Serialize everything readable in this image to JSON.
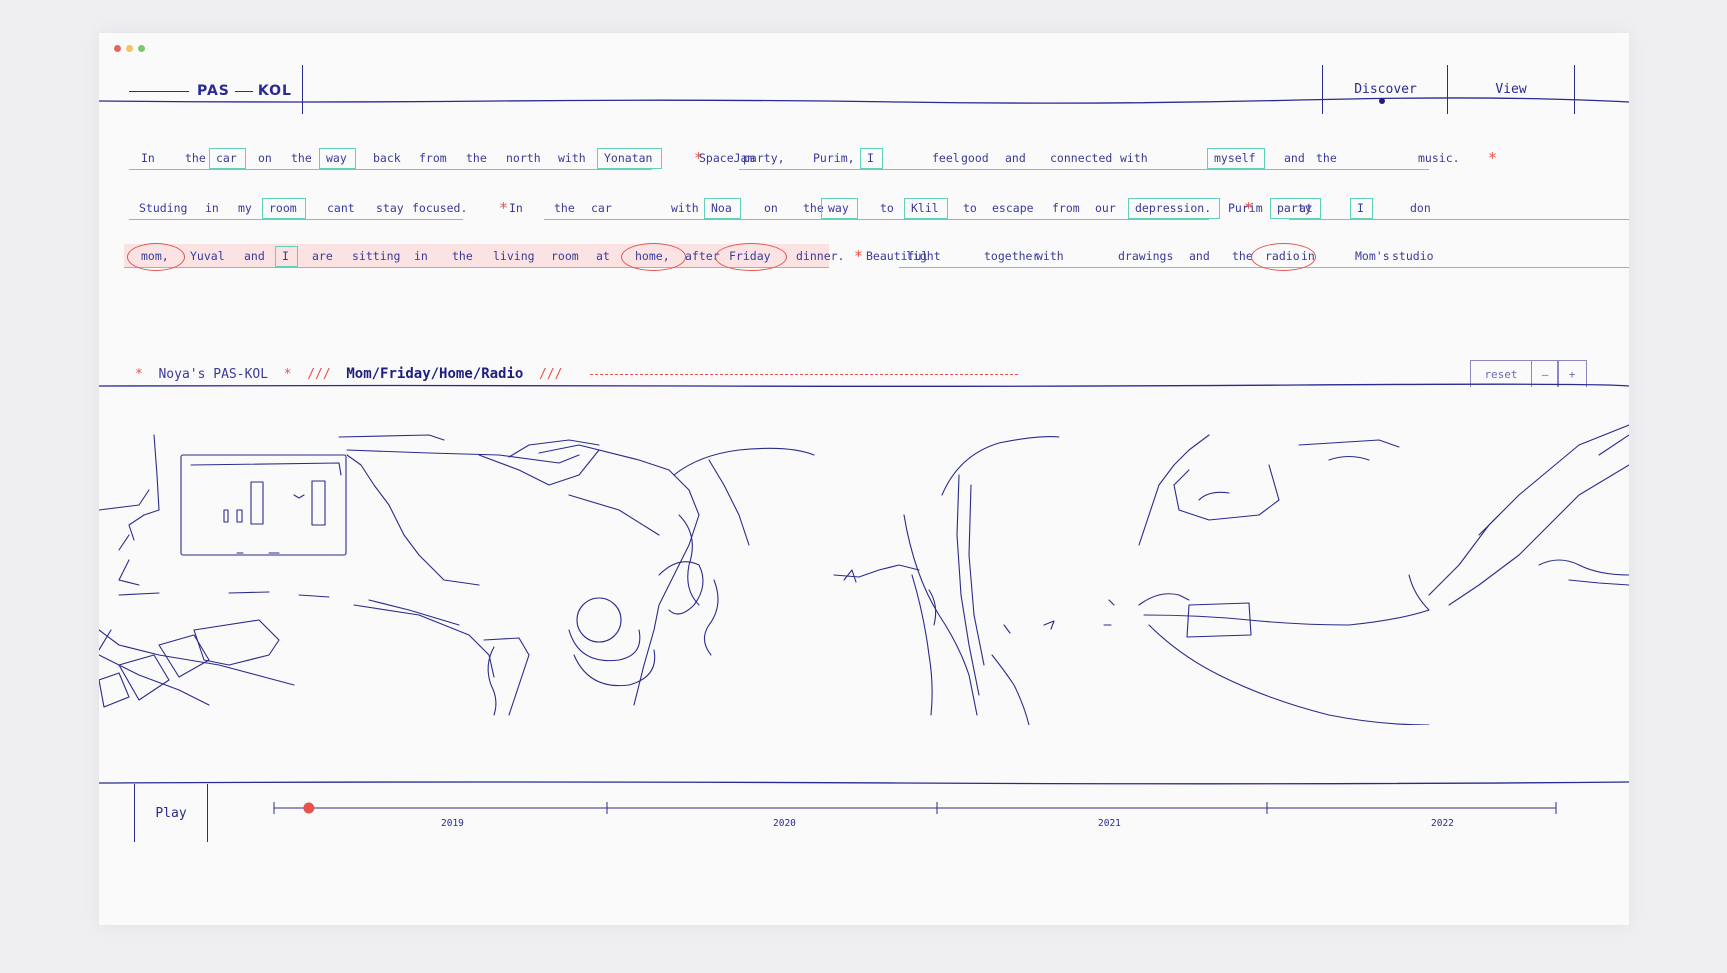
{
  "window": {
    "dot_colors": [
      "#e8655f",
      "#f0c75a",
      "#7cc66d"
    ]
  },
  "brand": {
    "left": "PAS",
    "right": "KOL"
  },
  "nav": {
    "items": [
      {
        "label": "Discover",
        "active": true
      },
      {
        "label": "View",
        "active": false
      }
    ]
  },
  "story": {
    "row1": [
      "In",
      "the",
      "car",
      "on",
      "the",
      "way",
      "back",
      "from",
      "the",
      "north",
      "with",
      "Yonatan",
      "*",
      "SpaceJam",
      "party,",
      "Purim,",
      "I",
      "feel",
      "good",
      "and",
      "connected",
      "with",
      "myself",
      "and",
      "the",
      "music.",
      "*"
    ],
    "row2": [
      "Studing",
      "in",
      "my",
      "room",
      "cant",
      "stay",
      "focused.",
      "*",
      "In",
      "the",
      "car",
      "with",
      "Noa",
      "on",
      "the",
      "way",
      "to",
      "Klil",
      "to",
      "escape",
      "from",
      "our",
      "depression.",
      "*",
      "Purim",
      "party",
      "at",
      "I",
      "don"
    ],
    "row3": [
      "mom,",
      "Yuval",
      "and",
      "I",
      "are",
      "sitting",
      "in",
      "the",
      "living",
      "room",
      "at",
      "home,",
      "after",
      "Friday",
      "dinner.",
      "*",
      "Beautiful",
      "light",
      "together",
      "with",
      "drawings",
      "and",
      "the",
      "radio",
      "in",
      "Mom's",
      "studio"
    ]
  },
  "breadcrumb": {
    "star": "*",
    "owner": "Noya's PAS-KOL",
    "slashes": "///",
    "path": "Mom/Friday/Home/Radio"
  },
  "controls": {
    "reset": "reset",
    "minus": "–",
    "plus": "+"
  },
  "player": {
    "play_label": "Play",
    "years": [
      "2019",
      "2020",
      "2021",
      "2022"
    ],
    "progress": 0.01
  },
  "colors": {
    "ink": "#2a2a8f",
    "accent_red": "#e8524a",
    "teal": "#63d1b8"
  }
}
